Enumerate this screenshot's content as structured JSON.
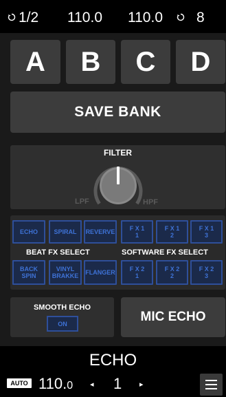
{
  "status": {
    "left_loop": "1/2",
    "left_bpm": "110.0",
    "right_bpm": "110.0",
    "right_loop": "8",
    "loop_icon": "loop-icon"
  },
  "banks": [
    "A",
    "B",
    "C",
    "D"
  ],
  "save_bank": "SAVE BANK",
  "filter": {
    "title": "FILTER",
    "low_label": "LPF",
    "high_label": "HPF"
  },
  "beat_fx": {
    "row1": [
      "ECHO",
      "SPIRAL",
      "REVERVE"
    ],
    "row2": [
      "BACK\nSPIN",
      "VINYL\nBRAKKE",
      "FLANGER"
    ],
    "label": "BEAT FX SELECT"
  },
  "software_fx": {
    "row1": [
      "F X 1\n1",
      "F X 1\n2",
      "F X 1\n3"
    ],
    "row2": [
      "F X 2\n1",
      "F X 2\n2",
      "F X 2\n3"
    ],
    "label": "SOFTWARE FX SELECT"
  },
  "smooth_echo": {
    "title": "SMOOTH ECHO",
    "toggle": "ON"
  },
  "mic_echo": "MIC ECHO",
  "bottom": {
    "fx_name": "ECHO",
    "auto": "AUTO",
    "bpm_int": "110.",
    "bpm_dec": "0",
    "beat": "1",
    "left_arrow": "◂",
    "right_arrow": "▸"
  },
  "colors": {
    "fx_fill": "#1b2a4a",
    "fx_border": "#2e4f9a",
    "fx_text": "#3e72d6"
  }
}
